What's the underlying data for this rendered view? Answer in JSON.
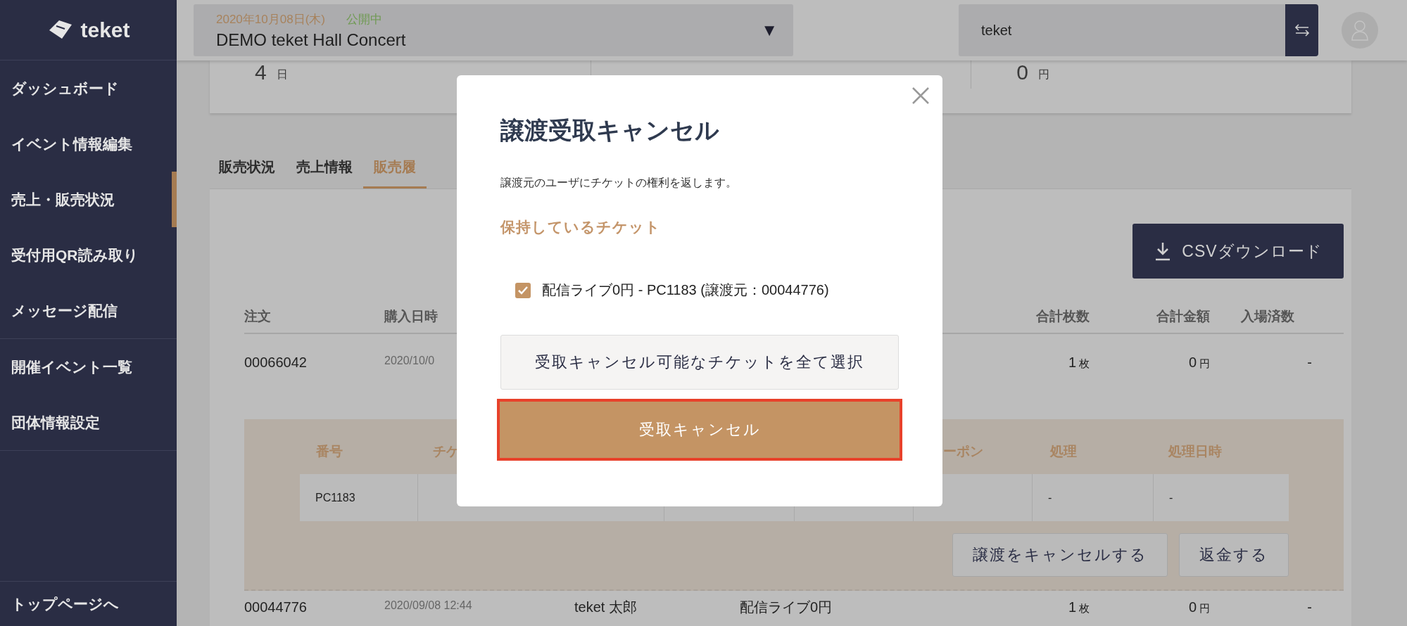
{
  "sidebar": {
    "logo": "teket",
    "menu_groups": [
      {
        "items": [
          {
            "label": "ダッシュボード",
            "selected": false
          },
          {
            "label": "イベント情報編集",
            "selected": false
          },
          {
            "label": "売上・販売状況",
            "selected": true
          },
          {
            "label": "受付用QR読み取り",
            "selected": false
          },
          {
            "label": "メッセージ配信",
            "selected": false
          }
        ]
      },
      {
        "items": [
          {
            "label": "開催イベント一覧",
            "selected": false
          },
          {
            "label": "団体情報設定",
            "selected": false
          }
        ]
      }
    ],
    "footer_link": "トップページへ"
  },
  "header": {
    "event": {
      "date": "2020年10月08日(木)",
      "status": "公開中",
      "name": "DEMO teket Hall Concert",
      "caret": "▼"
    },
    "organization_field": {
      "value": "teket"
    }
  },
  "stats": [
    {
      "value": "4",
      "unit": "日"
    },
    {
      "value": "0",
      "unit": "円"
    }
  ],
  "tabs": [
    {
      "label": "販売状況",
      "selected": false
    },
    {
      "label": "売上情報",
      "selected": false
    },
    {
      "label": "販売履",
      "selected": true
    }
  ],
  "csv_button": "CSVダウンロード",
  "orders": {
    "columns": {
      "order": "注文",
      "purchased_at": "購入日時",
      "quantity": "合計枚数",
      "amount": "合計金額",
      "entered": "入場済数"
    },
    "rows": [
      {
        "order": "00066042",
        "purchased_at": "2020/10/0",
        "quantity": "1",
        "quantity_unit": "枚",
        "amount": "0",
        "amount_unit": "円",
        "entered": "-",
        "expanded": true,
        "detail": {
          "columns": {
            "number": "番号",
            "ticket": "チケ",
            "coupon": "ーポン",
            "process": "処理",
            "processed_at": "処理日時"
          },
          "rows": [
            {
              "number": "PC1183",
              "process": "-",
              "processed_at": "-"
            }
          ],
          "buttons": [
            "譲渡をキャンセルする",
            "返金する"
          ]
        }
      },
      {
        "order": "00044776",
        "purchased_at": "2020/09/08 12:44",
        "buyer": "teket 太郎",
        "ticket": "配信ライブ0円",
        "quantity": "1",
        "quantity_unit": "枚",
        "amount": "0",
        "amount_unit": "円",
        "entered": "-",
        "expanded": false
      }
    ]
  },
  "modal": {
    "title": "譲渡受取キャンセル",
    "description": "譲渡元のユーザにチケットの権利を返します。",
    "section_title": "保持しているチケット",
    "tickets": [
      {
        "label": "配信ライブ0円 - PC1183 (譲渡元：00044776)",
        "checked": true
      }
    ],
    "select_all_button": "受取キャンセル可能なチケットを全て選択",
    "submit_button": "受取キャンセル"
  }
}
